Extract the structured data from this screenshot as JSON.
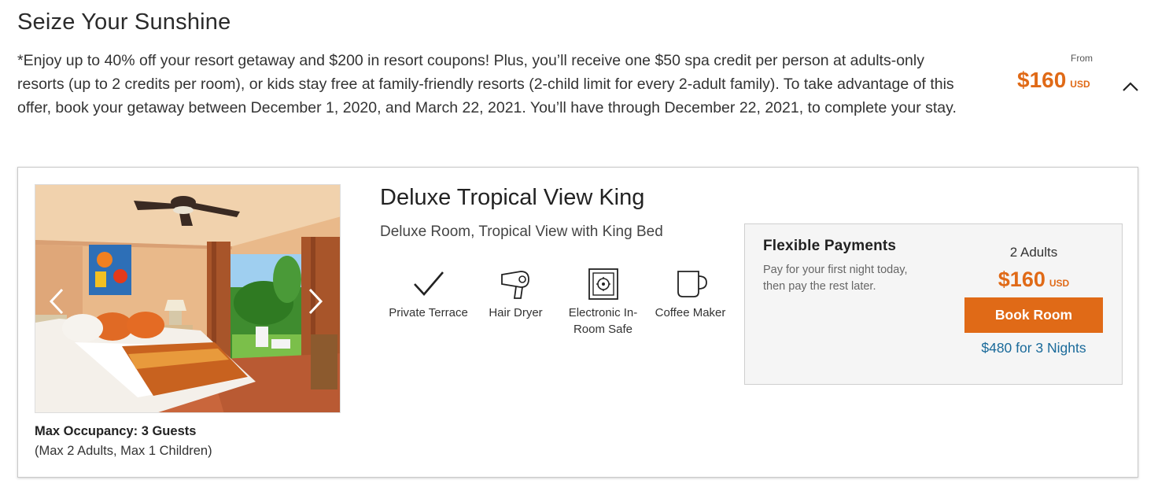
{
  "offer": {
    "title": "Seize Your Sunshine",
    "description": "*Enjoy up to 40% off your resort getaway and $200 in resort coupons! Plus, you’ll receive one $50 spa credit per person at adults-only resorts (up to 2 credits per room), or kids stay free at family-friendly resorts (2-child limit for every 2-adult family). To take advantage of this offer, book your getaway between December 1, 2020, and March 22, 2021. You’ll have through December 22, 2021, to complete your stay.",
    "from_label": "From",
    "price": "$160",
    "currency": "USD",
    "toggle_icon": "chevron-up-icon"
  },
  "room": {
    "name": "Deluxe Tropical View King",
    "description": "Deluxe Room, Tropical View with King Bed",
    "occupancy": "Max Occupancy: 3 Guests",
    "occupancy_detail": "(Max 2 Adults, Max 1 Children)",
    "amenities": [
      {
        "label": "Private Terrace",
        "icon": "checkmark-icon"
      },
      {
        "label": "Hair Dryer",
        "icon": "hair-dryer-icon"
      },
      {
        "label": "Electronic In-Room Safe",
        "icon": "safe-icon"
      },
      {
        "label": "Coffee Maker",
        "icon": "coffee-mug-icon"
      }
    ]
  },
  "payment": {
    "title": "Flexible Payments",
    "description": "Pay for your first night today, then pay the rest later.",
    "adults": "2 Adults",
    "price": "$160",
    "currency": "USD",
    "book_label": "Book Room",
    "total_link": "$480 for 3 Nights"
  },
  "colors": {
    "accent": "#e06a17",
    "link": "#1a6a9a"
  }
}
